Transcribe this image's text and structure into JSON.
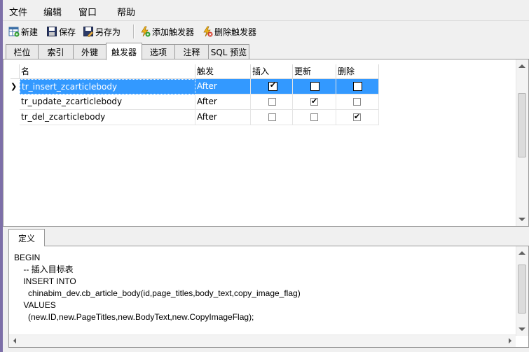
{
  "menu": [
    "文件",
    "编辑",
    "窗口",
    "帮助"
  ],
  "toolbar": {
    "new_label": "新建",
    "save_label": "保存",
    "save_as_label": "另存为",
    "add_trigger_label": "添加触发器",
    "delete_trigger_label": "删除触发器"
  },
  "tabs": [
    "栏位",
    "索引",
    "外键",
    "触发器",
    "选项",
    "注释",
    "SQL 预览"
  ],
  "active_tab": "触发器",
  "grid": {
    "headers": [
      "名",
      "触发",
      "插入",
      "更新",
      "删除"
    ],
    "rows": [
      {
        "name": "tr_insert_zcarticlebody",
        "trigger": "After",
        "insert": true,
        "update": false,
        "delete": false,
        "selected": true
      },
      {
        "name": "tr_update_zcarticlebody",
        "trigger": "After",
        "insert": false,
        "update": true,
        "delete": false,
        "selected": false
      },
      {
        "name": "tr_del_zcarticlebody",
        "trigger": "After",
        "insert": false,
        "update": false,
        "delete": true,
        "selected": false
      }
    ]
  },
  "definition": {
    "tab_label": "定义",
    "code": "BEGIN\n    -- 插入目标表\n    INSERT INTO\n      chinabim_dev.cb_article_body(id,page_titles,body_text,copy_image_flag)\n    VALUES\n      (new.ID,new.PageTitles,new.BodyText,new.CopyImageFlag);"
  },
  "colors": {
    "selection": "#3399ff",
    "sidebar_accent": "#7d6fa8"
  }
}
